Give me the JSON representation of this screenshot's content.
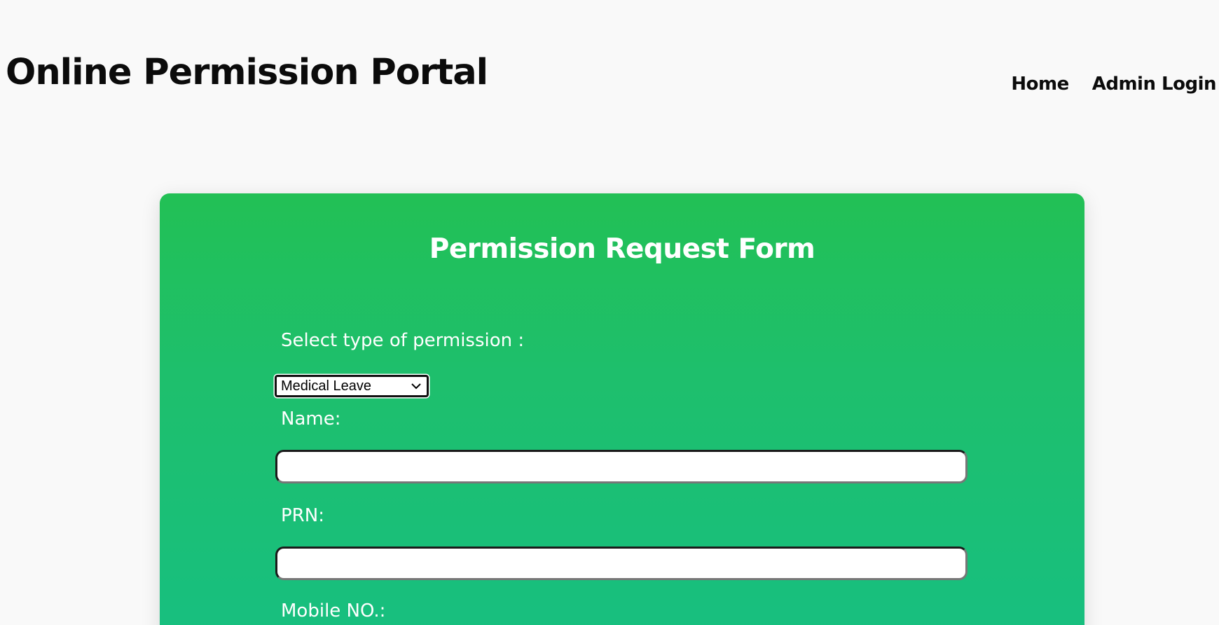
{
  "header": {
    "title": "Online Permission Portal",
    "nav": [
      {
        "label": "Home"
      },
      {
        "label": "Admin Login"
      }
    ]
  },
  "form": {
    "title": "Permission Request Form",
    "permission_type": {
      "label": "Select type of permission :",
      "selected": "Medical Leave"
    },
    "name": {
      "label": "Name:",
      "value": ""
    },
    "prn": {
      "label": "PRN:",
      "value": ""
    },
    "mobile": {
      "label": "Mobile NO.:"
    }
  },
  "colors": {
    "card_top": "#22c055",
    "card_bottom": "#17bf80",
    "page_background": "#f9f9f9"
  }
}
